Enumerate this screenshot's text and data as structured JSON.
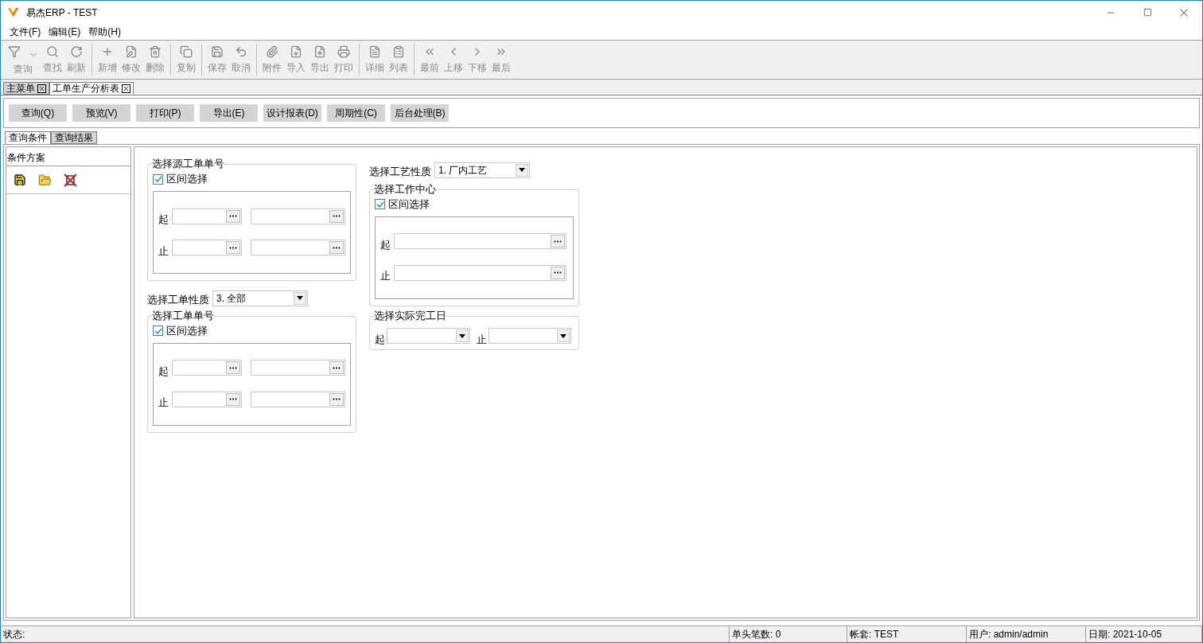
{
  "window": {
    "title": "易杰ERP - TEST"
  },
  "menu": [
    "文件(F)",
    "编辑(E)",
    "帮助(H)"
  ],
  "toolbar": {
    "groups": [
      [
        {
          "label": "查询",
          "disabled": true,
          "dropdown": true
        },
        {
          "label": "查找",
          "disabled": true,
          "dropdown": false
        },
        {
          "label": "刷新",
          "disabled": true,
          "dropdown": false
        }
      ],
      [
        {
          "label": "新增",
          "disabled": true,
          "dropdown": false
        },
        {
          "label": "修改",
          "disabled": true,
          "dropdown": false
        },
        {
          "label": "删除",
          "disabled": true,
          "dropdown": false
        }
      ],
      [
        {
          "label": "复制",
          "disabled": true,
          "dropdown": false
        }
      ],
      [
        {
          "label": "保存",
          "disabled": true,
          "dropdown": false
        },
        {
          "label": "取消",
          "disabled": true,
          "dropdown": false
        }
      ],
      [
        {
          "label": "附件",
          "disabled": true,
          "dropdown": false
        },
        {
          "label": "导入",
          "disabled": true,
          "dropdown": false
        },
        {
          "label": "导出",
          "disabled": true,
          "dropdown": false
        },
        {
          "label": "打印",
          "disabled": true,
          "dropdown": false
        }
      ],
      [
        {
          "label": "详细",
          "disabled": true,
          "dropdown": false
        },
        {
          "label": "列表",
          "disabled": true,
          "dropdown": false
        }
      ],
      [
        {
          "label": "最前",
          "disabled": true,
          "dropdown": false
        },
        {
          "label": "上移",
          "disabled": true,
          "dropdown": false
        },
        {
          "label": "下移",
          "disabled": true,
          "dropdown": false
        },
        {
          "label": "最后",
          "disabled": true,
          "dropdown": false
        }
      ]
    ]
  },
  "doc_tabs": [
    {
      "label": "主菜单",
      "selected": false
    },
    {
      "label": "工单生产分析表",
      "selected": true
    }
  ],
  "actions": [
    "查询(Q)",
    "预览(V)",
    "打印(P)",
    "导出(E)",
    "设计报表(D)",
    "周期性(C)",
    "后台处理(B)"
  ],
  "sub_tabs": [
    {
      "label": "查询条件",
      "selected": true
    },
    {
      "label": "查询结果",
      "selected": false
    }
  ],
  "scheme_panel": {
    "title": "条件方案"
  },
  "form": {
    "columns": [
      [
        {
          "kind": "range_double",
          "title": "选择源工单单号",
          "checkbox": {
            "label": "区间选择",
            "checked": true
          },
          "rows": [
            "起",
            "止"
          ]
        },
        {
          "kind": "select",
          "label": "选择工单性质",
          "value": "3. 全部"
        },
        {
          "kind": "range_double",
          "title": "选择工单单号",
          "checkbox": {
            "label": "区间选择",
            "checked": true
          },
          "rows": [
            "起",
            "止"
          ]
        }
      ],
      [
        {
          "kind": "select",
          "label": "选择工艺性质",
          "value": "1. 厂内工艺"
        },
        {
          "kind": "range_single",
          "title": "选择工作中心",
          "checkbox": {
            "label": "区间选择",
            "checked": true
          },
          "rows": [
            "起",
            "止"
          ]
        },
        {
          "kind": "dates",
          "title": "选择实际完工日",
          "from": "起",
          "to": "止"
        }
      ]
    ]
  },
  "status_bar": [
    "状态:",
    "单头笔数: 0",
    "帐套: TEST",
    "用户: admin/admin",
    "日期: 2021-10-05"
  ]
}
